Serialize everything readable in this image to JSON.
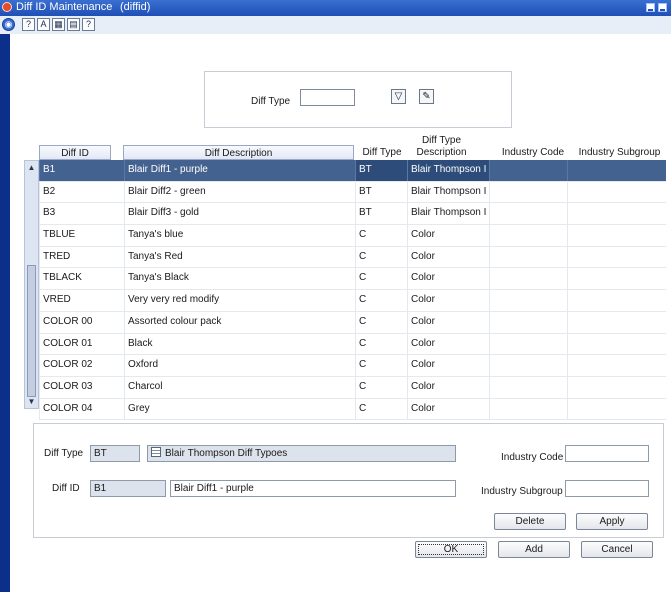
{
  "window": {
    "title": "Diff ID Maintenance",
    "subtitle": "(diffid)"
  },
  "toolbar": {
    "icons": [
      "globe-icon",
      "help-icon",
      "spell-icon",
      "calculator-icon",
      "calendar-icon",
      "info-icon"
    ]
  },
  "filter": {
    "label": "Diff Type",
    "value": ""
  },
  "grid": {
    "header_top": "Diff Type",
    "columns": [
      "Diff ID",
      "Diff Description",
      "Diff Type",
      "Description",
      "Industry Code",
      "Industry Subgroup"
    ],
    "rows": [
      [
        "B1",
        "Blair Diff1 - purple",
        "BT",
        "Blair Thompson I",
        "",
        ""
      ],
      [
        "B2",
        "Blair Diff2 - green",
        "BT",
        "Blair Thompson I",
        "",
        ""
      ],
      [
        "B3",
        "Blair Diff3 - gold",
        "BT",
        "Blair Thompson I",
        "",
        ""
      ],
      [
        "TBLUE",
        "Tanya's blue",
        "C",
        "Color",
        "",
        ""
      ],
      [
        "TRED",
        "Tanya's Red",
        "C",
        "Color",
        "",
        ""
      ],
      [
        "TBLACK",
        "Tanya's Black",
        "C",
        "Color",
        "",
        ""
      ],
      [
        "VRED",
        "Very very red modify",
        "C",
        "Color",
        "",
        ""
      ],
      [
        "COLOR 00",
        "Assorted colour pack",
        "C",
        "Color",
        "",
        ""
      ],
      [
        "COLOR 01",
        "Black",
        "C",
        "Color",
        "",
        ""
      ],
      [
        "COLOR 02",
        "Oxford",
        "C",
        "Color",
        "",
        ""
      ],
      [
        "COLOR 03",
        "Charcol",
        "C",
        "Color",
        "",
        ""
      ],
      [
        "COLOR 04",
        "Grey",
        "C",
        "Color",
        "",
        ""
      ]
    ],
    "selected_row": 0
  },
  "detail": {
    "diff_type_label": "Diff Type",
    "diff_type_value": "BT",
    "diff_type_desc": "Blair Thompson Diff Typoes",
    "diff_id_label": "Diff ID",
    "diff_id_value": "B1",
    "diff_desc_value": "Blair Diff1 - purple",
    "industry_code_label": "Industry Code",
    "industry_code_value": "",
    "industry_subgroup_label": "Industry Subgroup",
    "industry_subgroup_value": ""
  },
  "buttons": {
    "delete": "Delete",
    "apply": "Apply",
    "ok": "OK",
    "add": "Add",
    "cancel": "Cancel"
  },
  "colors": {
    "title_bar": "#1f4fb6",
    "selected_row": "#44628f",
    "left_bar": "#0b2f8a"
  }
}
